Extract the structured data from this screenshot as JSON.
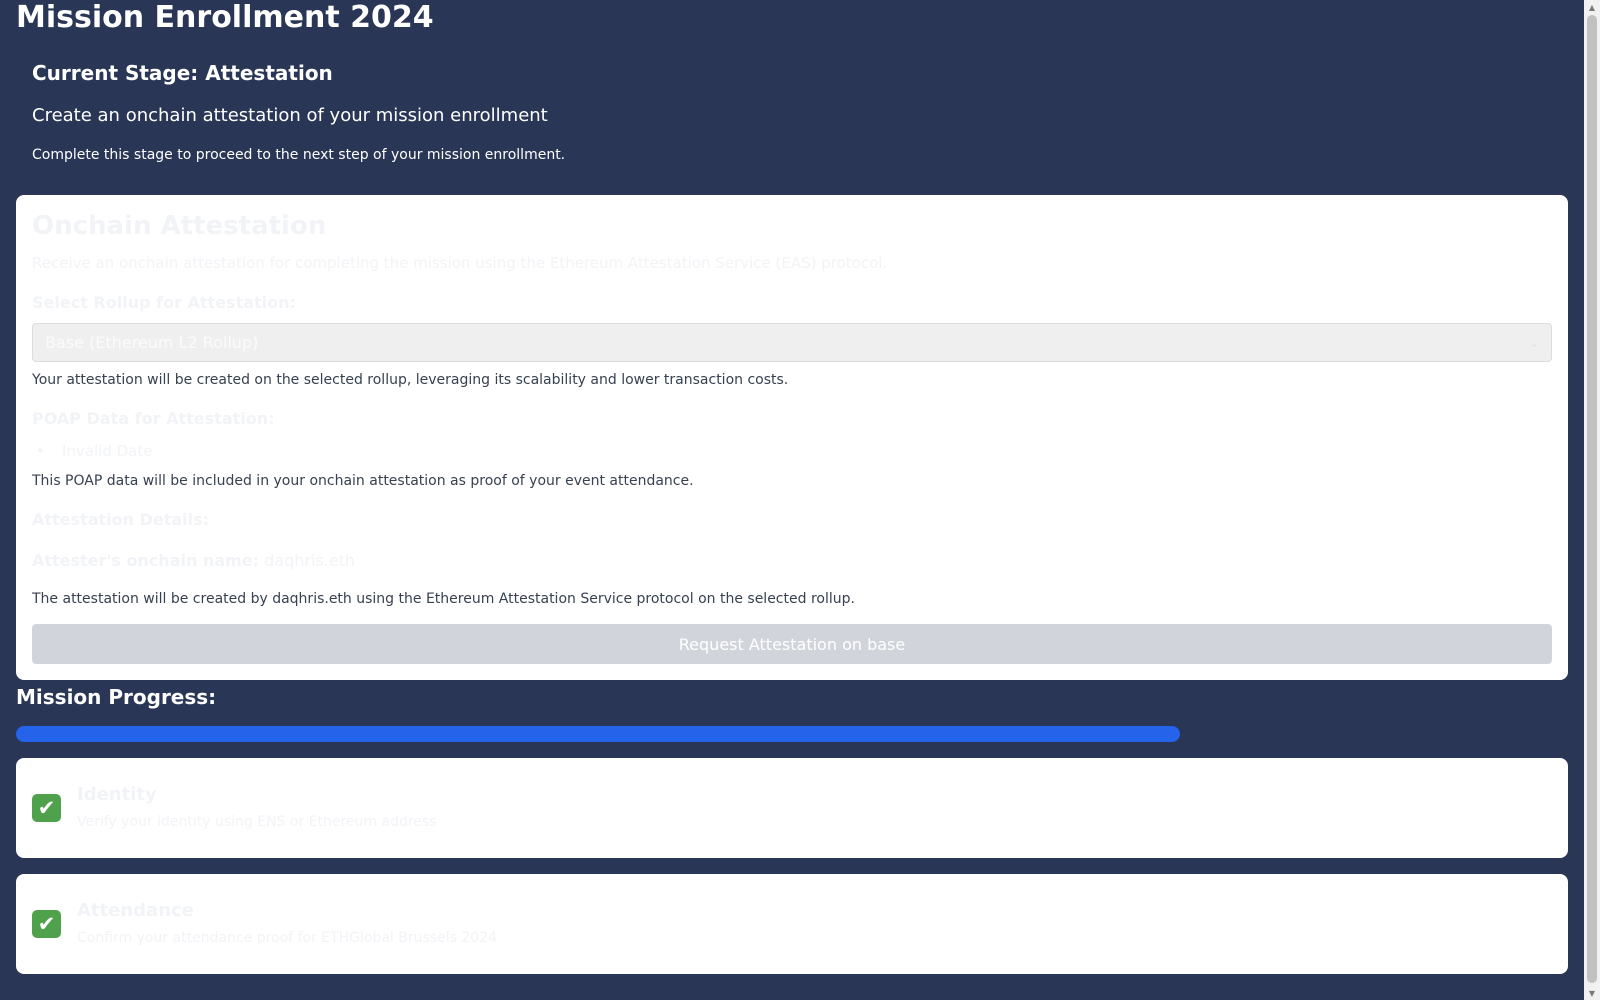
{
  "page": {
    "title": "Mission Enrollment 2024"
  },
  "stage": {
    "title": "Current Stage: Attestation",
    "subtitle": "Create an onchain attestation of your mission enrollment",
    "note": "Complete this stage to proceed to the next step of your mission enrollment."
  },
  "attestation": {
    "title": "Onchain Attestation",
    "description": "Receive an onchain attestation for completing the mission using the Ethereum Attestation Service (EAS) protocol.",
    "rollup_label": "Select Rollup for Attestation:",
    "rollup_selected": "Base (Ethereum L2 Rollup)",
    "rollup_helper": "Your attestation will be created on the selected rollup, leveraging its scalability and lower transaction costs.",
    "poap_label": "POAP Data for Attestation:",
    "poap_items": [
      "Invalid Date"
    ],
    "poap_helper": "This POAP data will be included in your onchain attestation as proof of your event attendance.",
    "details_label": "Attestation Details:",
    "attester_label": "Attester's onchain name:",
    "attester_value": "daqhris.eth",
    "attester_helper": "The attestation will be created by daqhris.eth using the Ethereum Attestation Service protocol on the selected rollup.",
    "request_button": "Request Attestation on base"
  },
  "progress": {
    "title": "Mission Progress:",
    "percent": 75,
    "fill_color": "#2563eb"
  },
  "steps": [
    {
      "title": "Identity",
      "description": "Verify your identity using ENS or Ethereum address",
      "icon": "check-mark-icon",
      "status": "done"
    },
    {
      "title": "Attendance",
      "description": "Confirm your attendance proof for ETHGlobal Brussels 2024",
      "icon": "check-mark-icon",
      "status": "done"
    }
  ],
  "icons": {
    "check": "✔",
    "chevron": "⌄",
    "bullet": "•",
    "scroll_up": "▲",
    "scroll_down": "▼"
  }
}
